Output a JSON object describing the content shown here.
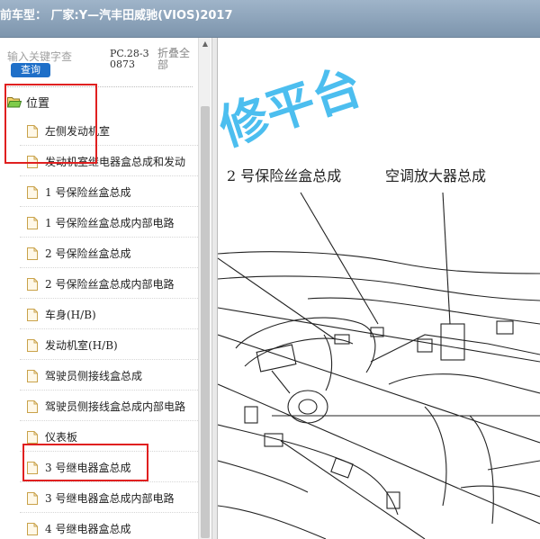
{
  "header": {
    "title": "前车型：  厂家:Y—汽丰田威驰(VIOS)2017"
  },
  "search": {
    "placeholder": "输入关键字查",
    "query_label": "查询",
    "pc_code": "PC.28-30873",
    "collapse_all": "折叠全部"
  },
  "tree": {
    "folder_label": "位置",
    "items": [
      {
        "label": "左侧发动机室"
      },
      {
        "label": "发动机室继电器盒总成和发动"
      },
      {
        "label": "1 号保险丝盒总成"
      },
      {
        "label": "1 号保险丝盒总成内部电路"
      },
      {
        "label": "2 号保险丝盒总成"
      },
      {
        "label": "2 号保险丝盒总成内部电路"
      },
      {
        "label": "车身(H/B)"
      },
      {
        "label": "发动机室(H/B)"
      },
      {
        "label": "驾驶员侧接线盒总成"
      },
      {
        "label": "驾驶员侧接线盒总成内部电路"
      },
      {
        "label": "仪表板"
      },
      {
        "label": "3 号继电器盒总成"
      },
      {
        "label": "3 号继电器盒总成内部电路"
      },
      {
        "label": "4 号继电器盒总成"
      }
    ]
  },
  "diagram": {
    "watermark": "修平台",
    "label_fuse": "2 号保险丝盒总成",
    "label_amp": "空调放大器总成"
  },
  "colors": {
    "accent": "#1e6fc8",
    "highlight": "#e02020",
    "watermark": "#39b8ee",
    "titlebar": "#8aa1b8"
  },
  "icons": {
    "folder": "folder-open-icon",
    "document": "document-icon"
  }
}
